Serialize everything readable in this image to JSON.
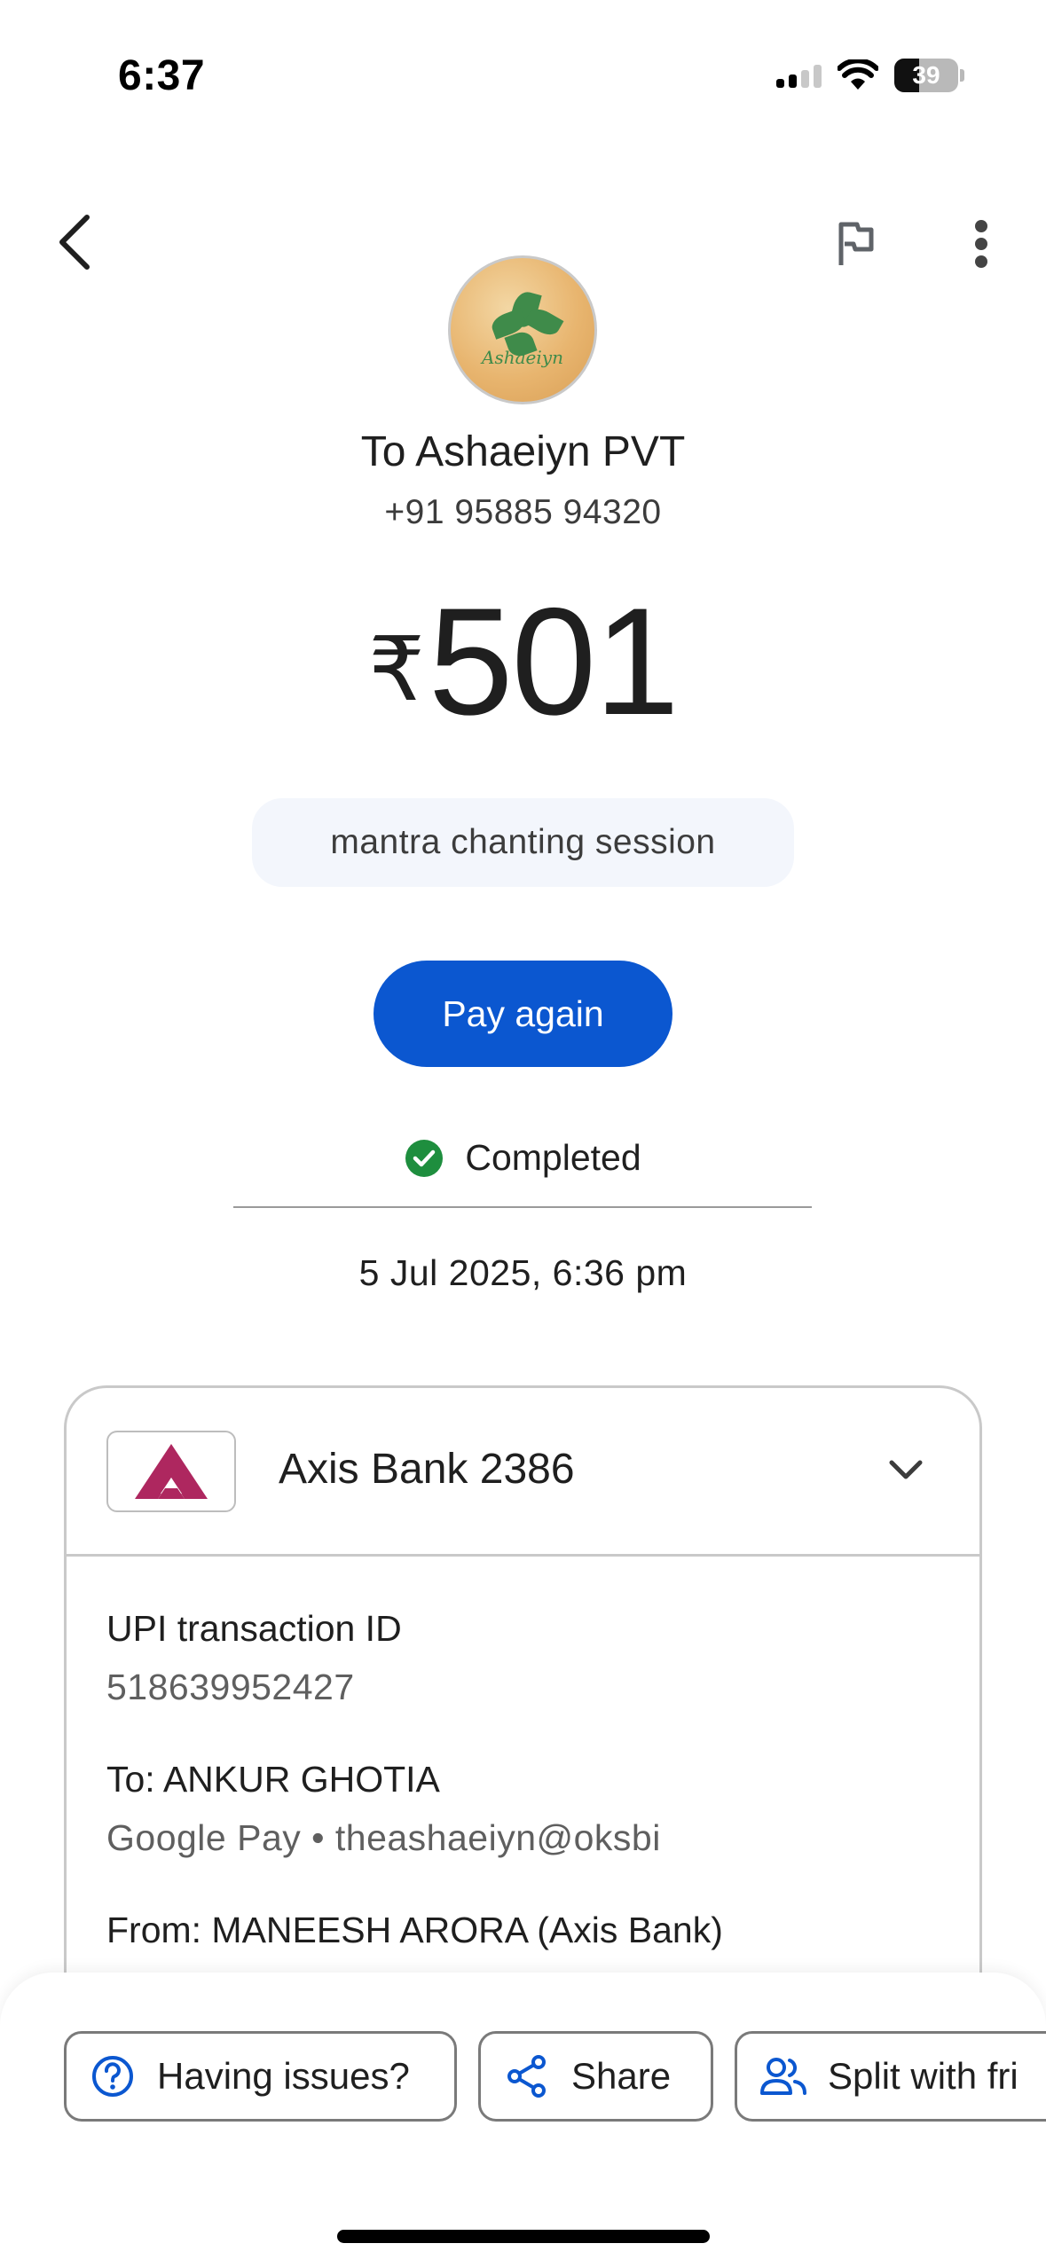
{
  "status_bar": {
    "time": "6:37",
    "battery": "39"
  },
  "header": {
    "back_label": "Back",
    "report_label": "Report",
    "more_label": "More options"
  },
  "payee": {
    "avatar_text": "Ashaeiyn",
    "name": "To Ashaeiyn PVT",
    "phone": "+91 95885 94320"
  },
  "payment": {
    "currency": "₹",
    "amount": "501",
    "note": "mantra chanting session",
    "pay_again_label": "Pay again",
    "status": "Completed",
    "datetime": "5 Jul 2025, 6:36 pm"
  },
  "details": {
    "bank_name": "Axis Bank 2386",
    "upi_label": "UPI transaction ID",
    "upi_id": "518639952427",
    "to_label": "To: ANKUR GHOTIA",
    "to_sub": "Google Pay • theashaeiyn@oksbi",
    "from_label": "From: MANEESH ARORA (Axis Bank)"
  },
  "actions": {
    "issues_label": "Having issues?",
    "share_label": "Share",
    "split_label": "Split with fri"
  },
  "colors": {
    "accent": "#0b57d0",
    "success": "#1e8e3e",
    "axis_brand": "#ae275f"
  },
  "icons": [
    "back-arrow-icon",
    "flag-icon",
    "more-vert-icon",
    "check-circle-icon",
    "chevron-down-icon",
    "help-icon",
    "share-icon",
    "people-icon",
    "axis-bank-logo"
  ]
}
